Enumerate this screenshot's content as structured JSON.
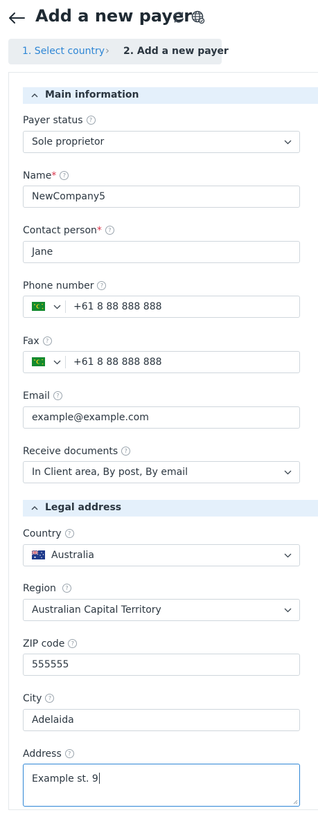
{
  "header": {
    "title": "Add a new payer"
  },
  "steps": [
    {
      "label": "1. Select country"
    },
    {
      "label": "2. Add a new payer"
    }
  ],
  "step_separator": "›",
  "help_mark": "?",
  "required_mark": "*",
  "sections": {
    "main": {
      "label": "Main information"
    },
    "legal": {
      "label": "Legal address"
    }
  },
  "fields": {
    "payer_status": {
      "label": "Payer status",
      "value": "Sole proprietor"
    },
    "name": {
      "label": "Name",
      "value": "NewCompany5"
    },
    "contact_person": {
      "label": "Contact person",
      "value": "Jane"
    },
    "phone": {
      "label": "Phone number",
      "value": "+61 8 88 888 888",
      "flag": "cocos-islands-flag-icon"
    },
    "fax": {
      "label": "Fax",
      "value": "+61 8 88 888 888",
      "flag": "cocos-islands-flag-icon"
    },
    "email": {
      "label": "Email",
      "value": "example@example.com"
    },
    "receive_documents": {
      "label": "Receive documents",
      "value": "In Client area, By post, By email"
    },
    "country": {
      "label": "Country",
      "value": "Australia",
      "flag": "australia-flag-icon"
    },
    "region": {
      "label": "Region",
      "value": "Australian Capital Territory"
    },
    "zip": {
      "label": "ZIP code",
      "value": "555555"
    },
    "city": {
      "label": "City",
      "value": "Adelaida"
    },
    "address": {
      "label": "Address",
      "value": "Example st. 9"
    }
  },
  "colors": {
    "accent": "#2e86d5",
    "section_bg": "#e4f0fb",
    "required": "#d9344a",
    "steps_bg": "#eaeef1"
  }
}
